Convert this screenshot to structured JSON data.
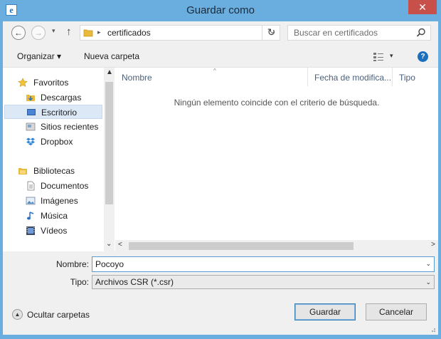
{
  "window": {
    "title": "Guardar como",
    "close_glyph": "✕",
    "app_icon": "ie-icon"
  },
  "navbar": {
    "back_glyph": "←",
    "forward_glyph": "→",
    "history_glyph": "▾",
    "up_glyph": "↑",
    "breadcrumb_sep": "▸",
    "location": "certificados",
    "address_drop_glyph": "⌄",
    "refresh_glyph": "↻",
    "search_placeholder": "Buscar en certificados"
  },
  "toolbar": {
    "organize": "Organizar ▾",
    "new_folder": "Nueva carpeta",
    "view_drop_glyph": "▾",
    "help_glyph": "?"
  },
  "sidebar": {
    "items": [
      {
        "label": "Favoritos",
        "icon": "star-icon",
        "group": true
      },
      {
        "label": "Descargas",
        "icon": "downloads-icon"
      },
      {
        "label": "Escritorio",
        "icon": "desktop-icon",
        "selected": true
      },
      {
        "label": "Sitios recientes",
        "icon": "recent-icon"
      },
      {
        "label": "Dropbox",
        "icon": "dropbox-icon"
      },
      {
        "label": "Bibliotecas",
        "icon": "libraries-icon",
        "group": true
      },
      {
        "label": "Documentos",
        "icon": "documents-icon"
      },
      {
        "label": "Imágenes",
        "icon": "pictures-icon"
      },
      {
        "label": "Música",
        "icon": "music-icon"
      },
      {
        "label": "Vídeos",
        "icon": "videos-icon"
      }
    ],
    "scroll_up": "▲",
    "scroll_down": "⌄"
  },
  "file_list": {
    "columns": [
      "Nombre",
      "Fecha de modifica...",
      "Tipo"
    ],
    "sort_glyph": "^",
    "empty_message": "Ningún elemento coincide con el criterio de búsqueda.",
    "hscroll_left": "<",
    "hscroll_right": ">"
  },
  "form": {
    "filename_label": "Nombre:",
    "filename_value": "Pocoyo",
    "filetype_label": "Tipo:",
    "filetype_value": "Archivos CSR (*.csr)",
    "drop_glyph": "⌄"
  },
  "footer": {
    "hide_folders": "Ocultar carpetas",
    "hide_glyph": "▲",
    "save": "Guardar",
    "cancel": "Cancelar"
  },
  "colors": {
    "frame": "#6aaedf",
    "close": "#c7504a",
    "selection": "#dce8f6",
    "accent": "#1a6fc0"
  }
}
